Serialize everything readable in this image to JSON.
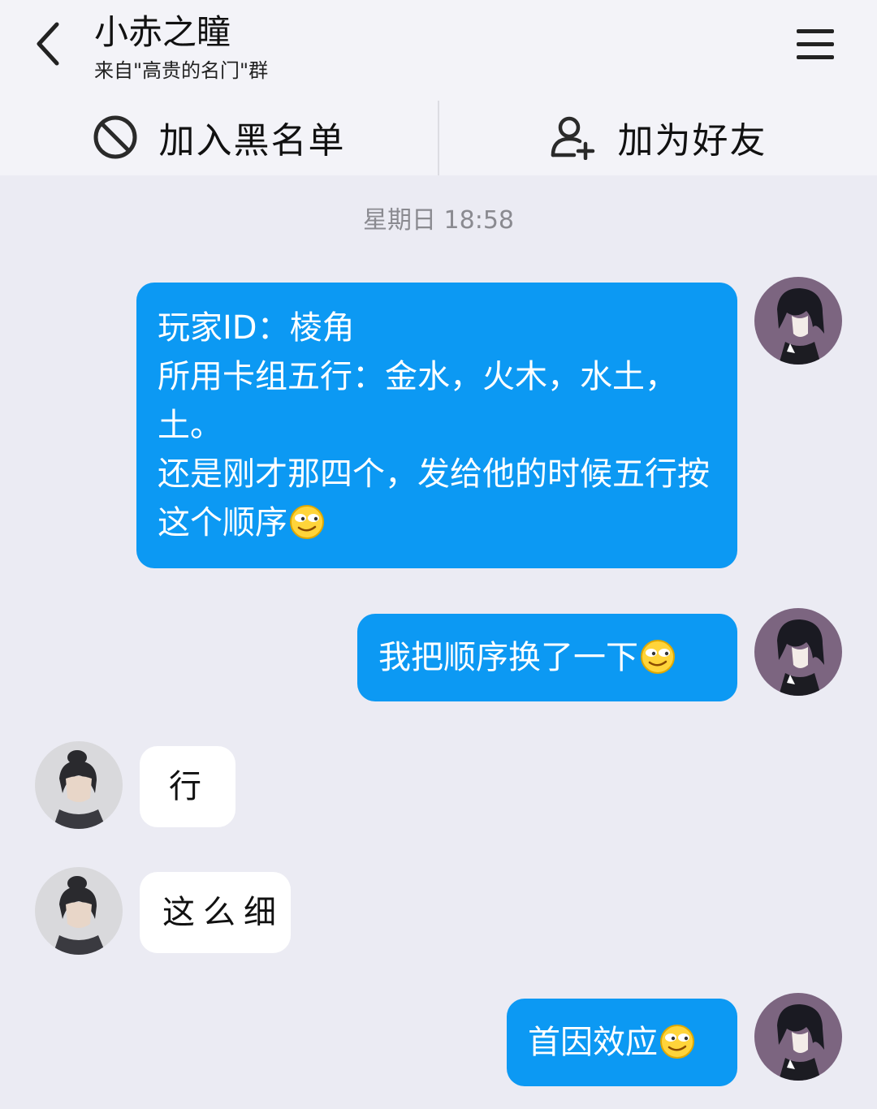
{
  "header": {
    "title": "小赤之瞳",
    "subtitle": "来自\"高贵的名门\"群"
  },
  "actions": {
    "blacklist_label": "加入黑名单",
    "add_friend_label": "加为好友"
  },
  "chat": {
    "timestamp": "星期日 18:58",
    "messages": [
      {
        "side": "out",
        "text": "玩家ID：棱角\n所用卡组五行：金水，火木，水土，土。\n还是刚才那四个，发给他的时候五行按这个顺序",
        "emoji": "smirk-emoji"
      },
      {
        "side": "out",
        "text": "我把顺序换了一下",
        "emoji": "smirk-emoji"
      },
      {
        "side": "in",
        "text": "行"
      },
      {
        "side": "in",
        "text": "这么细"
      },
      {
        "side": "out",
        "text": "首因效应",
        "emoji": "smirk-emoji"
      }
    ]
  },
  "colors": {
    "outgoing_bubble": "#0c99f3",
    "incoming_bubble": "#ffffff",
    "background": "#ebebf3"
  }
}
